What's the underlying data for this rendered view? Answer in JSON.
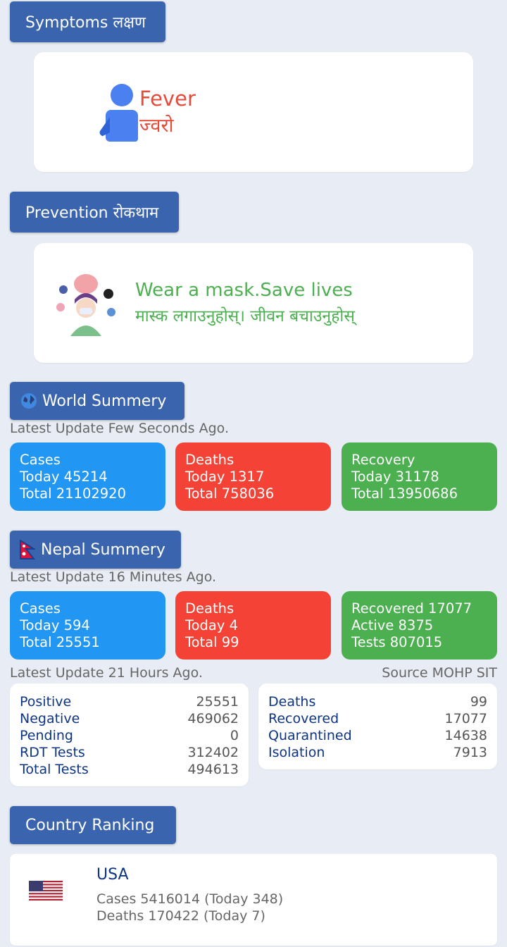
{
  "symptoms": {
    "header": "Symptoms लक्षण",
    "title": "Fever",
    "title_np": "ज्वरो",
    "icon": "person-icon"
  },
  "prevention": {
    "header": "Prevention रोकथाम",
    "title": "Wear a mask.Save lives",
    "title_np": "मास्क लगाउनुहोस्। जीवन बचाउनुहोस्",
    "icon": "mask-illustration-icon"
  },
  "world": {
    "header": "World Summery",
    "update": "Latest Update Few Seconds Ago.",
    "cases": {
      "label": "Cases",
      "today": "Today 45214",
      "total": "Total 21102920"
    },
    "deaths": {
      "label": "Deaths",
      "today": "Today 1317",
      "total": "Total 758036"
    },
    "recovery": {
      "label": "Recovery",
      "today": "Today 31178",
      "total": "Total 13950686"
    }
  },
  "nepal": {
    "header": "Nepal Summery",
    "update": "Latest Update 16 Minutes Ago.",
    "cases": {
      "label": "Cases",
      "today": "Today 594",
      "total": "Total 25551"
    },
    "deaths": {
      "label": "Deaths",
      "today": "Today 4",
      "total": "Total 99"
    },
    "other": {
      "recovered": "Recovered 17077",
      "active": "Active 8375",
      "tests": "Tests 807015"
    },
    "update2": "Latest Update 21 Hours Ago.",
    "source": "Source MOHP SIT",
    "left_table": [
      {
        "label": "Positive",
        "value": "25551"
      },
      {
        "label": "Negative",
        "value": "469062"
      },
      {
        "label": "Pending",
        "value": "0"
      },
      {
        "label": "RDT Tests",
        "value": "312402"
      },
      {
        "label": "Total Tests",
        "value": "494613"
      }
    ],
    "right_table": [
      {
        "label": "Deaths",
        "value": "99"
      },
      {
        "label": "Recovered",
        "value": "17077"
      },
      {
        "label": "Quarantined",
        "value": "14638"
      },
      {
        "label": "Isolation",
        "value": "7913"
      }
    ]
  },
  "ranking": {
    "header": "Country Ranking",
    "country": "USA",
    "cases": "Cases 5416014 (Today 348)",
    "deaths": "Deaths 170422 (Today 7)"
  },
  "colors": {
    "header_bg": "#3a64ad",
    "cases": "#2196f3",
    "deaths": "#f44336",
    "recovery": "#4caf50",
    "fever_text": "#e64a3b",
    "prevention_text": "#4caf50",
    "table_label": "#0d3484"
  }
}
